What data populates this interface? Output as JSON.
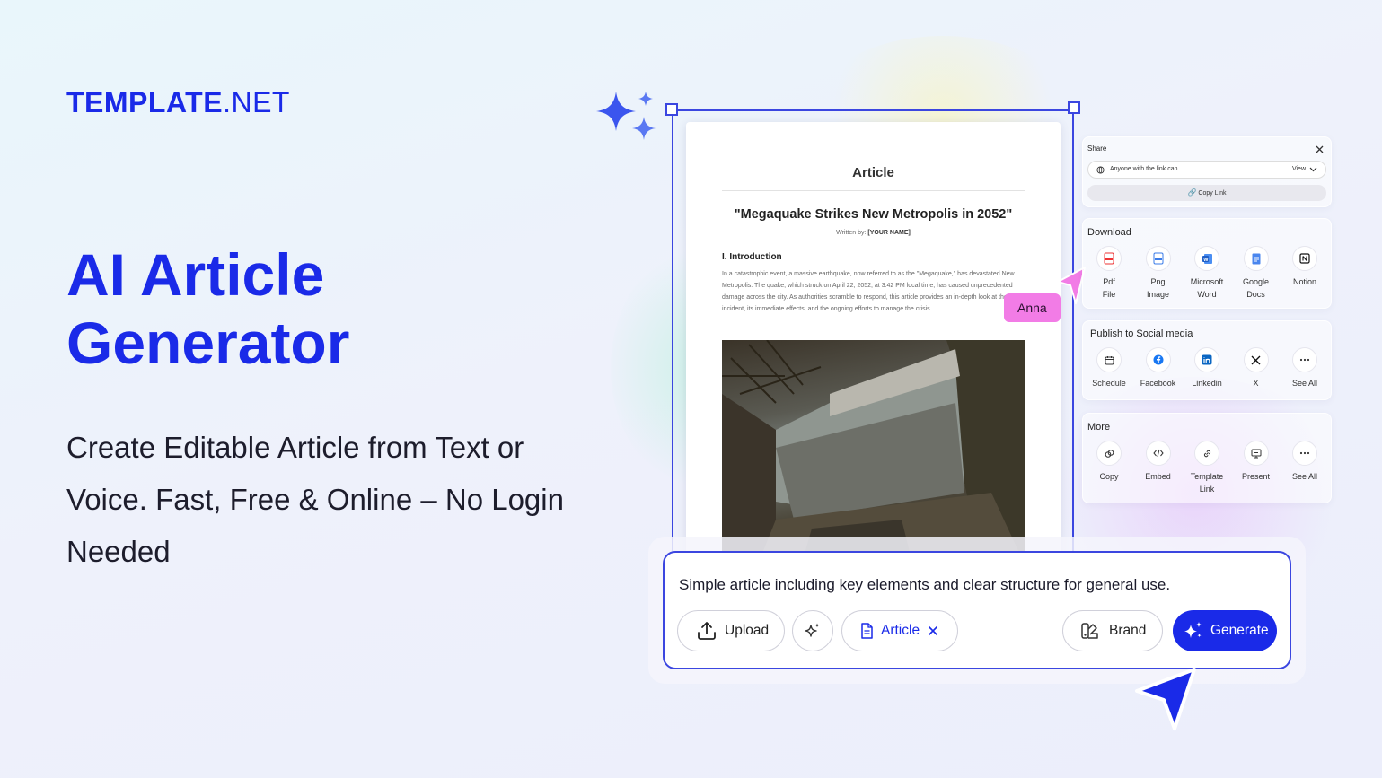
{
  "brand": {
    "logo_bold": "TEMPLATE",
    "logo_light": ".NET"
  },
  "hero": {
    "title_line1": "AI Article",
    "title_line2": "Generator",
    "subtitle": "Create Editable Article from Text or Voice. Fast, Free & Online – No Login Needed"
  },
  "document": {
    "title": "Article",
    "headline": "\"Megaquake Strikes New Metropolis in 2052\"",
    "byline_prefix": "Written by:",
    "byline_name": "[YOUR NAME]",
    "section": "I. Introduction",
    "paragraph": "In a catastrophic event, a massive earthquake, now referred to as the \"Megaquake,\" has devastated New Metropolis. The quake, which struck on April 22, 2052, at 3:42 PM local time, has caused unprecedented damage across the city. As authorities scramble to respond, this article provides an in-depth look at the incident, its immediate effects, and the ongoing efforts to manage the crisis."
  },
  "collaborator": {
    "name": "Anna",
    "color": "#f27ce6"
  },
  "share": {
    "title": "Share",
    "access_text": "Anyone with the link can",
    "access_level": "View",
    "copy_link": "Copy Link"
  },
  "download": {
    "title": "Download",
    "items": [
      {
        "line1": "Pdf",
        "line2": "File",
        "icon": "pdf-icon"
      },
      {
        "line1": "Png",
        "line2": "Image",
        "icon": "image-icon"
      },
      {
        "line1": "Microsoft",
        "line2": "Word",
        "icon": "word-icon"
      },
      {
        "line1": "Google",
        "line2": "Docs",
        "icon": "google-docs-icon"
      },
      {
        "line1": "Notion",
        "line2": "",
        "icon": "notion-icon"
      }
    ]
  },
  "social": {
    "title": "Publish to Social media",
    "items": [
      {
        "label": "Schedule",
        "icon": "calendar-icon"
      },
      {
        "label": "Facebook",
        "icon": "facebook-icon"
      },
      {
        "label": "Linkedin",
        "icon": "linkedin-icon"
      },
      {
        "label": "X",
        "icon": "x-icon"
      },
      {
        "label": "See All",
        "icon": "more-icon"
      }
    ]
  },
  "more": {
    "title": "More",
    "items": [
      {
        "line1": "Copy",
        "line2": "",
        "icon": "copy-icon"
      },
      {
        "line1": "Embed",
        "line2": "",
        "icon": "embed-icon"
      },
      {
        "line1": "Template",
        "line2": "Link",
        "icon": "link-icon"
      },
      {
        "line1": "Present",
        "line2": "",
        "icon": "present-icon"
      },
      {
        "line1": "See All",
        "line2": "",
        "icon": "more-icon"
      }
    ]
  },
  "prompt": {
    "text": "Simple article including key elements and clear structure for general use.",
    "upload_label": "Upload",
    "type_label": "Article",
    "brand_label": "Brand",
    "generate_label": "Generate"
  },
  "colors": {
    "accent": "#1a2ae8",
    "frame": "#3b46e0",
    "collaborator": "#f27ce6"
  }
}
